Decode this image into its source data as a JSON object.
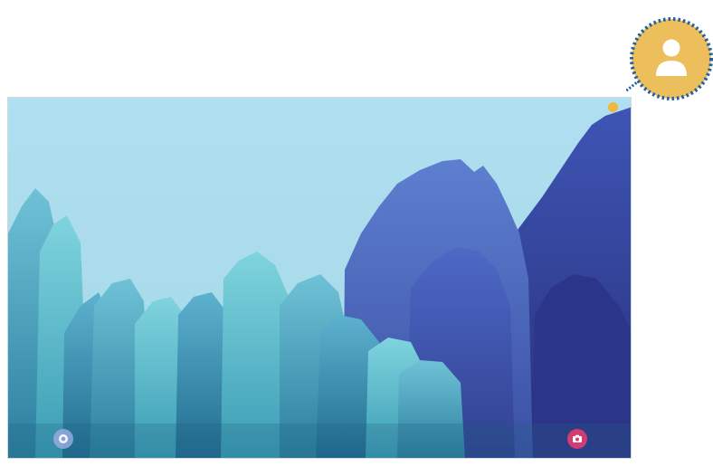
{
  "lock_screen": {
    "status_left_text": "",
    "status_right_text": "",
    "clock_text": "",
    "date_text": "",
    "swipe_hint_text": ""
  },
  "callout": {
    "icon": "user-profile-icon",
    "color": "#EDBE5C",
    "border_color": "#1f5fa6"
  },
  "shortcuts": {
    "left_icon": "phone-app-icon",
    "right_icon": "camera-icon"
  }
}
